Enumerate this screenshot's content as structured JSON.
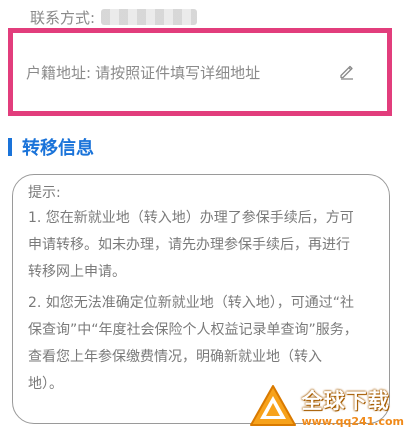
{
  "contact": {
    "label": "联系方式:"
  },
  "address": {
    "label": "户籍地址:",
    "value": "请按照证件填写详细地址",
    "edit_icon": "pencil-icon"
  },
  "section": {
    "title": "转移信息",
    "accent": "#1a73d9"
  },
  "tip": {
    "title": "提示:",
    "lines": [
      "1. 您在新就业地（转入地）办理了参保手续后，方可",
      "申请转移。如未办理，请先办理参保手续后，再进行",
      "转移网上申请。",
      "2. 如您无法准确定位新就业地（转入地），可通过“社",
      "保查询”中“年度社会保险个人权益记录单查询”服务，",
      "查看您上年参保缴费情况，明确新就业地（转入",
      "地）。"
    ]
  },
  "highlight_color": "#e23d7c",
  "watermark": {
    "name": "全球下载",
    "url": "www.qq241.com"
  }
}
